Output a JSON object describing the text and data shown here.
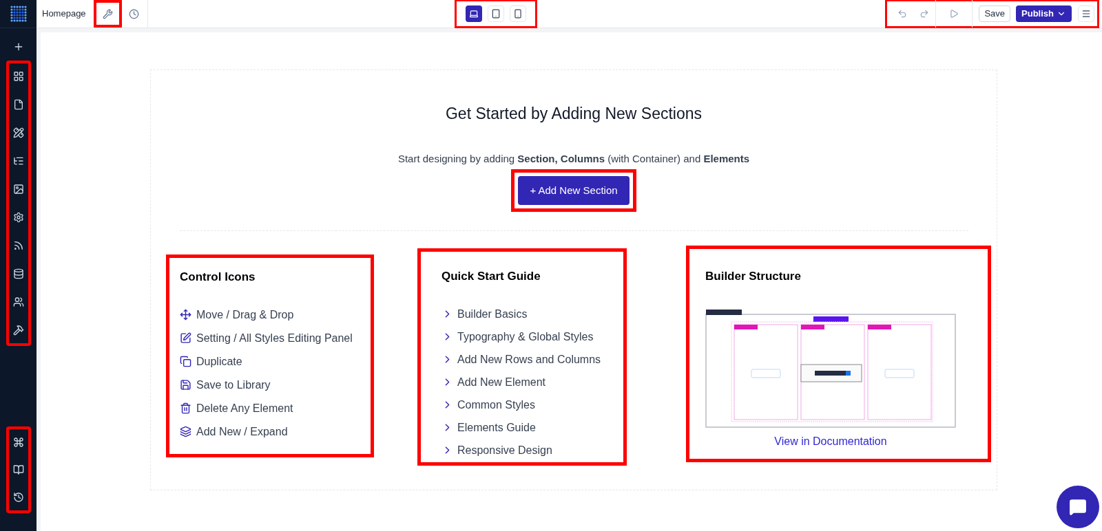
{
  "topbar": {
    "page_title": "Homepage",
    "devices": [
      {
        "selected": true
      },
      {
        "selected": false
      },
      {
        "selected": false
      }
    ],
    "save": "Save",
    "publish": "Publish"
  },
  "hero": {
    "title": "Get Started by Adding New Sections",
    "subtitle": "Start designing by adding **Section, Columns** (with Container) and **Elements**",
    "button": "+ Add New Section"
  },
  "control_icons": {
    "title": "Control Icons",
    "items": [
      "Move / Drag & Drop",
      "Setting / All Styles Editing Panel",
      "Duplicate",
      "Save to Library",
      "Delete Any Element",
      "Add New / Expand"
    ]
  },
  "quick_start": {
    "title": "Quick Start Guide",
    "items": [
      "Builder Basics",
      "Typography & Global Styles",
      "Add New Rows and Columns",
      "Add New Element",
      "Common Styles",
      "Elements Guide",
      "Responsive Design"
    ]
  },
  "builder_structure": {
    "title": "Builder Structure",
    "link": "View in Documentation"
  }
}
